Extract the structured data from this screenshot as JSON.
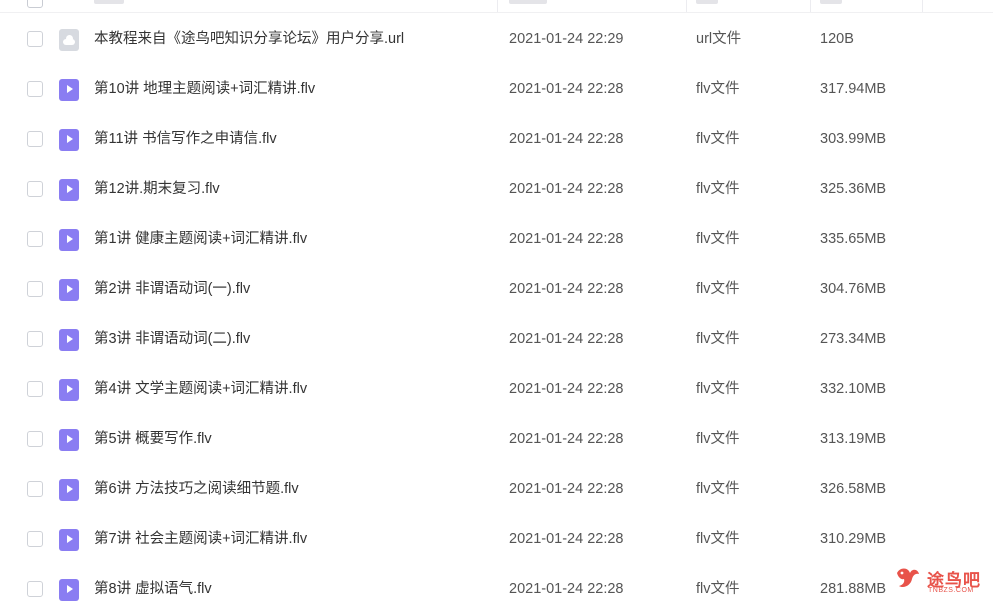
{
  "files": [
    {
      "name": "本教程来自《途鸟吧知识分享论坛》用户分享.url",
      "date": "2021-01-24 22:29",
      "type": "url文件",
      "size": "120B",
      "icon": "link-file-icon"
    },
    {
      "name": "第10讲 地理主题阅读+词汇精讲.flv",
      "date": "2021-01-24 22:28",
      "type": "flv文件",
      "size": "317.94MB",
      "icon": "video-file-icon"
    },
    {
      "name": "第11讲 书信写作之申请信.flv",
      "date": "2021-01-24 22:28",
      "type": "flv文件",
      "size": "303.99MB",
      "icon": "video-file-icon"
    },
    {
      "name": "第12讲.期末复习.flv",
      "date": "2021-01-24 22:28",
      "type": "flv文件",
      "size": "325.36MB",
      "icon": "video-file-icon"
    },
    {
      "name": "第1讲 健康主题阅读+词汇精讲.flv",
      "date": "2021-01-24 22:28",
      "type": "flv文件",
      "size": "335.65MB",
      "icon": "video-file-icon"
    },
    {
      "name": "第2讲 非谓语动词(一).flv",
      "date": "2021-01-24 22:28",
      "type": "flv文件",
      "size": "304.76MB",
      "icon": "video-file-icon"
    },
    {
      "name": "第3讲 非谓语动词(二).flv",
      "date": "2021-01-24 22:28",
      "type": "flv文件",
      "size": "273.34MB",
      "icon": "video-file-icon"
    },
    {
      "name": "第4讲 文学主题阅读+词汇精讲.flv",
      "date": "2021-01-24 22:28",
      "type": "flv文件",
      "size": "332.10MB",
      "icon": "video-file-icon"
    },
    {
      "name": "第5讲 概要写作.flv",
      "date": "2021-01-24 22:28",
      "type": "flv文件",
      "size": "313.19MB",
      "icon": "video-file-icon"
    },
    {
      "name": "第6讲 方法技巧之阅读细节题.flv",
      "date": "2021-01-24 22:28",
      "type": "flv文件",
      "size": "326.58MB",
      "icon": "video-file-icon"
    },
    {
      "name": "第7讲 社会主题阅读+词汇精讲.flv",
      "date": "2021-01-24 22:28",
      "type": "flv文件",
      "size": "310.29MB",
      "icon": "video-file-icon"
    },
    {
      "name": "第8讲 虚拟语气.flv",
      "date": "2021-01-24 22:28",
      "type": "flv文件",
      "size": "281.88MB",
      "icon": "video-file-icon"
    }
  ],
  "watermark": {
    "text": "途鸟吧",
    "sub": "TNBZS.COM",
    "icon": "bird-logo-icon"
  },
  "colors": {
    "video_icon": "#8a7df2",
    "link_icon": "#d7dae0",
    "watermark": "#e8534a"
  }
}
